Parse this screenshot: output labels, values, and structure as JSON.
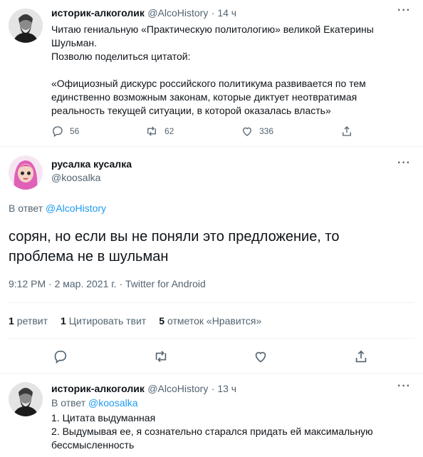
{
  "tweet1": {
    "name": "историк-алкоголик",
    "handle": "@AlcoHistory",
    "time": "· 14 ч",
    "lines": [
      "Читаю гениальную «Практическую политологию» великой Екатерины",
      "Шульман.",
      "Позволю поделиться цитатой:",
      "",
      "«Официозный дискурс российского политикума развивается по тем",
      "единственно возможным законам, которые диктует неотвратимая",
      "реальность текущей ситуации, в которой оказалась власть»"
    ],
    "replies": "56",
    "retweets": "62",
    "likes": "336"
  },
  "main": {
    "name": "русалка кусалка",
    "handle": "@koosalka",
    "reply_prefix": "В ответ",
    "reply_to": "@AlcoHistory",
    "text_line1": "сорян, но если вы не поняли это предложение, то",
    "text_line2": "проблема не в шульман",
    "meta": "9:12 PM · 2 мар. 2021 г. · Twitter for Android",
    "stats": {
      "retweets_count": "1",
      "retweets_label": "ретвит",
      "quotes_count": "1",
      "quotes_label": "Цитировать твит",
      "likes_count": "5",
      "likes_label": "отметок «Нравится»"
    }
  },
  "tweet3": {
    "name": "историк-алкоголик",
    "handle": "@AlcoHistory",
    "time": "· 13 ч",
    "reply_prefix": "В ответ",
    "reply_to": "@koosalka",
    "lines": [
      "1. Цитата выдуманная",
      "2. Выдумывая ее, я сознательно старался придать ей максимальную",
      "бессмысленность"
    ]
  },
  "icons": [
    "reply-icon",
    "retweet-icon",
    "like-icon",
    "share-icon",
    "more-icon"
  ],
  "colors": {
    "accent": "#1d9bf0",
    "muted": "#536471",
    "text": "#0f1419",
    "divider": "#eff3f4"
  }
}
